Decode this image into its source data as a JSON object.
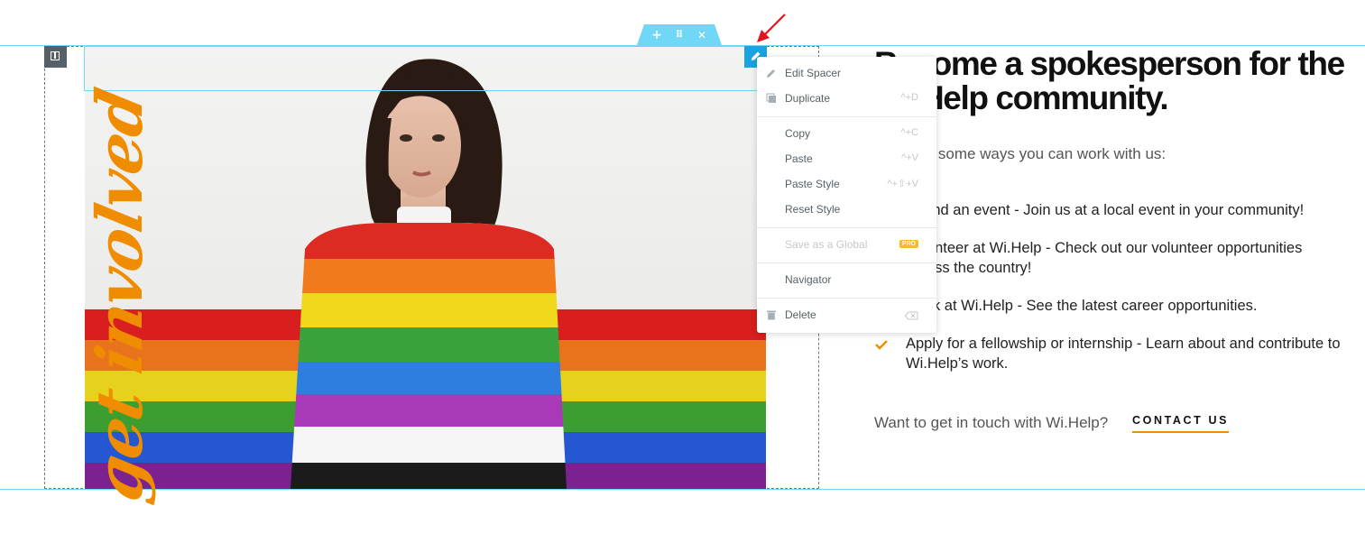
{
  "handle": {
    "add": "+",
    "move": "⠿",
    "close": "✕"
  },
  "image": {
    "script_text": "get involved"
  },
  "content": {
    "heading_line1": "Become a spokesperson for the",
    "heading_line2": "Wi.Help community.",
    "intro": "Here are some ways you can work with us:",
    "items": [
      "Attend an event - Join us at a local event in your community!",
      "Volunteer at Wi.Help - Check out our volunteer opportunities across the country!",
      "Work at Wi.Help - See the latest career opportunities.",
      "Apply for a fellowship or internship - Learn about and contribute to Wi.Help’s work."
    ],
    "touch": "Want to get in touch with Wi.Help?",
    "contact": "CONTACT US"
  },
  "menu": {
    "edit": "Edit Spacer",
    "duplicate": "Duplicate",
    "duplicate_key": "^+D",
    "copy": "Copy",
    "copy_key": "^+C",
    "paste": "Paste",
    "paste_key": "^+V",
    "paste_style": "Paste Style",
    "paste_style_key": "^+⇧+V",
    "reset_style": "Reset Style",
    "save_global": "Save as a Global",
    "pro": "PRO",
    "navigator": "Navigator",
    "delete": "Delete"
  },
  "colors": {
    "accent_blue": "#71d7f7",
    "edit_blue": "#19a3e0",
    "orange": "#f08c00",
    "arrow_red": "#e3141b"
  }
}
